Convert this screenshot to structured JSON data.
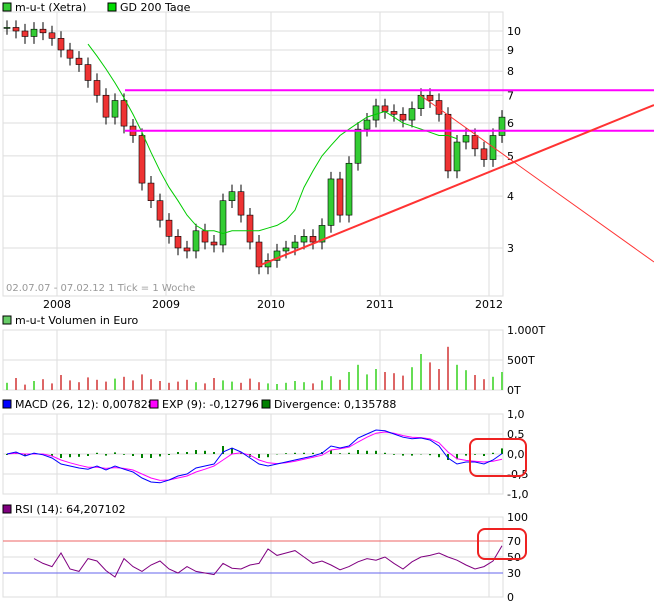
{
  "chart_data": [
    {
      "type": "candlestick",
      "legend": [
        {
          "name": "m-u-t (Xetra)",
          "color": "#33cc33"
        },
        {
          "name": "GD 200 Tage",
          "color": "#00dd00"
        }
      ],
      "range_text": "02.07.07 - 07.02.12   1 Tick = 1 Woche",
      "x_ticks": [
        "2008",
        "2009",
        "2010",
        "2011",
        "2012"
      ],
      "y_ticks": [
        "10",
        "9",
        "8",
        "7",
        "6",
        "5",
        "4",
        "3"
      ],
      "y_scale": "log",
      "start_month": "2007-07",
      "closes": [
        10.2,
        10.0,
        9.7,
        10.1,
        9.9,
        9.6,
        9.0,
        8.6,
        8.3,
        7.6,
        7.0,
        6.2,
        6.8,
        5.9,
        5.6,
        4.3,
        3.9,
        3.5,
        3.2,
        3.0,
        2.95,
        3.3,
        3.1,
        3.05,
        3.9,
        4.1,
        3.6,
        3.1,
        2.7,
        2.8,
        2.95,
        3.0,
        3.1,
        3.2,
        3.1,
        3.4,
        4.4,
        3.6,
        4.8,
        5.8,
        6.1,
        6.6,
        6.4,
        6.3,
        6.1,
        6.5,
        7.0,
        6.8,
        6.3,
        4.6,
        5.4,
        5.6,
        5.2,
        4.9,
        5.6,
        6.2
      ],
      "gd200_start_month": "2008-04",
      "gd200": [
        9.3,
        8.7,
        8.1,
        7.5,
        6.9,
        6.3,
        5.7,
        5.1,
        4.6,
        4.2,
        3.9,
        3.6,
        3.4,
        3.3,
        3.3,
        3.25,
        3.3,
        3.3,
        3.3,
        3.3,
        3.35,
        3.4,
        3.5,
        3.7,
        4.2,
        4.6,
        5.0,
        5.3,
        5.6,
        5.8,
        6.0,
        6.2,
        6.3,
        6.4,
        6.2,
        6.0,
        5.9,
        5.8,
        5.7,
        5.6,
        5.6,
        5.5
      ],
      "resistance_levels": [
        7.2,
        5.75
      ],
      "resistance_color": "#ff00ff",
      "trend_color": "#ff3333"
    },
    {
      "type": "bar",
      "legend": "m-u-t Volumen in Euro",
      "y_ticks": [
        "1.000T",
        "500T",
        "0T"
      ],
      "ylim": [
        0,
        1000
      ],
      "values": [
        120,
        200,
        90,
        150,
        180,
        110,
        250,
        160,
        130,
        210,
        170,
        140,
        190,
        220,
        160,
        260,
        180,
        150,
        120,
        140,
        170,
        130,
        110,
        200,
        160,
        140,
        120,
        190,
        130,
        110,
        100,
        120,
        150,
        130,
        110,
        160,
        230,
        170,
        300,
        420,
        260,
        350,
        300,
        280,
        240,
        380,
        600,
        460,
        350,
        720,
        420,
        330,
        250,
        180,
        220,
        300
      ]
    },
    {
      "type": "line",
      "legend": [
        {
          "name": "MACD (26, 12): 0,007828",
          "color": "#0000ff"
        },
        {
          "name": "EXP (9): -0,12796",
          "color": "#ff00ff"
        },
        {
          "name": "Divergence: 0,135788",
          "color": "#008000"
        }
      ],
      "y_ticks": [
        "1,0",
        "0,5",
        "0,0",
        "-0,5",
        "-1,0"
      ],
      "ylim": [
        -1,
        1
      ],
      "macd": [
        0,
        0.05,
        -0.05,
        0.02,
        -0.02,
        -0.1,
        -0.25,
        -0.3,
        -0.35,
        -0.38,
        -0.3,
        -0.4,
        -0.3,
        -0.38,
        -0.45,
        -0.6,
        -0.7,
        -0.72,
        -0.65,
        -0.55,
        -0.5,
        -0.35,
        -0.3,
        -0.25,
        0.05,
        0.15,
        0.05,
        -0.1,
        -0.25,
        -0.3,
        -0.25,
        -0.2,
        -0.15,
        -0.1,
        -0.05,
        0.02,
        0.2,
        0.15,
        0.2,
        0.4,
        0.5,
        0.6,
        0.58,
        0.5,
        0.42,
        0.38,
        0.4,
        0.35,
        0.2,
        -0.1,
        -0.25,
        -0.2,
        -0.2,
        -0.25,
        -0.15,
        0.01
      ],
      "exp": [
        0,
        0.02,
        0,
        0,
        0,
        -0.05,
        -0.15,
        -0.22,
        -0.28,
        -0.33,
        -0.33,
        -0.36,
        -0.34,
        -0.36,
        -0.4,
        -0.5,
        -0.6,
        -0.66,
        -0.65,
        -0.6,
        -0.55,
        -0.45,
        -0.38,
        -0.3,
        -0.15,
        0,
        0.03,
        -0.03,
        -0.15,
        -0.22,
        -0.24,
        -0.22,
        -0.18,
        -0.13,
        -0.08,
        -0.03,
        0.1,
        0.13,
        0.17,
        0.3,
        0.42,
        0.52,
        0.55,
        0.52,
        0.46,
        0.42,
        0.41,
        0.38,
        0.28,
        0.05,
        -0.12,
        -0.16,
        -0.18,
        -0.2,
        -0.18,
        -0.13
      ]
    },
    {
      "type": "line",
      "legend": {
        "name": "RSI (14): 64,207102",
        "color": "#800080"
      },
      "y_ticks": [
        "100",
        "70",
        "50",
        "30",
        "0"
      ],
      "ylim": [
        0,
        100
      ],
      "overbought": 70,
      "oversold": 30,
      "start_month": "2007-10",
      "rsi": [
        48,
        42,
        38,
        55,
        35,
        32,
        48,
        45,
        33,
        25,
        48,
        38,
        32,
        40,
        45,
        35,
        30,
        38,
        32,
        30,
        28,
        42,
        36,
        35,
        40,
        42,
        60,
        52,
        55,
        58,
        50,
        42,
        45,
        40,
        34,
        38,
        44,
        48,
        46,
        50,
        42,
        35,
        44,
        50,
        52,
        55,
        50,
        46,
        40,
        35,
        38,
        45,
        64
      ]
    }
  ]
}
